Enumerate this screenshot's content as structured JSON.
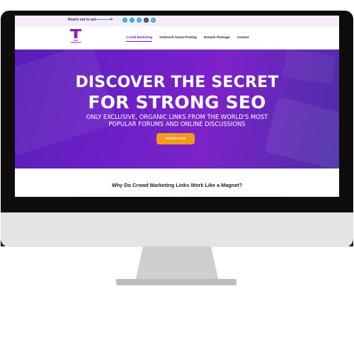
{
  "topbar": {
    "reach_label": "Reach out to us!",
    "social_icons": [
      "twitter-icon",
      "facebook-icon",
      "linkedin-icon",
      "instagram-icon",
      "telegram-icon"
    ]
  },
  "nav": {
    "logo_text": "SEO PREMIUM",
    "items": [
      {
        "label": "Crowd Marketing",
        "active": true
      },
      {
        "label": "Outreach Guest Posting",
        "active": false
      },
      {
        "label": "Domain Package",
        "active": false
      },
      {
        "label": "Contact",
        "active": false
      }
    ]
  },
  "hero": {
    "headline_line1": "DISCOVER THE SECRET",
    "headline_line2": "FOR STRONG SEO",
    "subheadline_line1": "ONLY EXCLUSIVE, ORGANIC LINKS FROM THE WORLD'S MOST",
    "subheadline_line2": "POPULAR FORUMS AND ONLINE DISCUSSIONS",
    "cta_label": "ORDER NOW"
  },
  "section": {
    "title": "Why Do Crowd Marketing Links Work Like a Magnet?"
  },
  "colors": {
    "accent": "#6b1fc7",
    "hero_start": "#5a1eb8",
    "hero_end": "#4b2fa6",
    "cta": "#f39a1d"
  }
}
